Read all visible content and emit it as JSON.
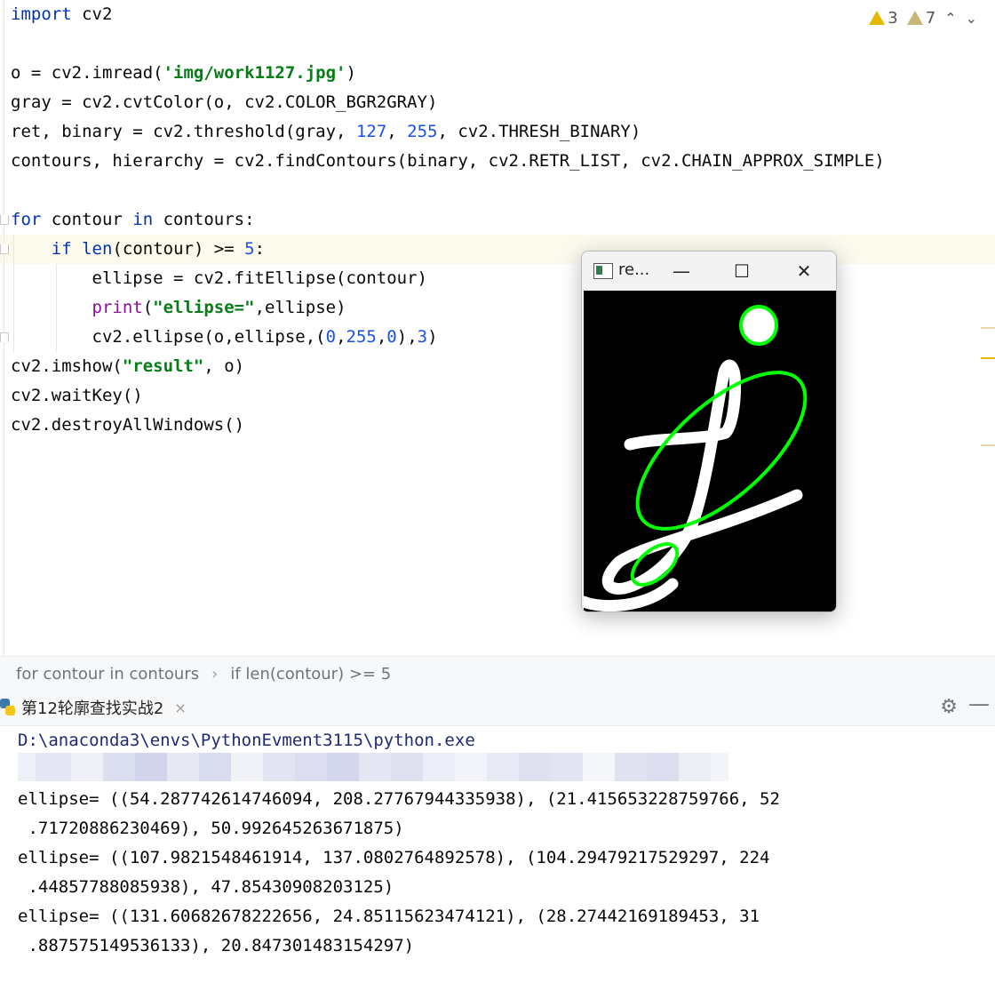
{
  "editor": {
    "lines": [
      [
        {
          "t": "import",
          "c": "kw"
        },
        {
          "t": " cv2",
          "c": ""
        }
      ],
      [],
      [
        {
          "t": "o = cv2.imread(",
          "c": ""
        },
        {
          "t": "'img/work1127.jpg'",
          "c": "str"
        },
        {
          "t": ")",
          "c": ""
        }
      ],
      [
        {
          "t": "gray = cv2.cvtColor(o, cv2.COLOR_BGR2GRAY)",
          "c": ""
        }
      ],
      [
        {
          "t": "ret, binary = cv2.threshold(gray, ",
          "c": ""
        },
        {
          "t": "127",
          "c": "num"
        },
        {
          "t": ", ",
          "c": ""
        },
        {
          "t": "255",
          "c": "num"
        },
        {
          "t": ", cv2.THRESH_BINARY)",
          "c": ""
        }
      ],
      [
        {
          "t": "contours, hierarchy = cv2.findContours(binary, cv2.RETR_LIST, cv2.CHAIN_APPROX_SIMPLE)",
          "c": ""
        }
      ],
      [],
      [
        {
          "t": "for",
          "c": "kw"
        },
        {
          "t": " contour ",
          "c": ""
        },
        {
          "t": "in",
          "c": "kw"
        },
        {
          "t": " contours:",
          "c": ""
        }
      ],
      [
        {
          "t": "    ",
          "c": ""
        },
        {
          "t": "if",
          "c": "kw"
        },
        {
          "t": " ",
          "c": ""
        },
        {
          "t": "len",
          "c": "kw"
        },
        {
          "t": "(contour) >= ",
          "c": ""
        },
        {
          "t": "5",
          "c": "num"
        },
        {
          "t": ":",
          "c": ""
        }
      ],
      [
        {
          "t": "        ellipse = cv2.fitEllipse(contour)",
          "c": ""
        }
      ],
      [
        {
          "t": "        ",
          "c": ""
        },
        {
          "t": "print",
          "c": "fn"
        },
        {
          "t": "(",
          "c": ""
        },
        {
          "t": "\"ellipse=\"",
          "c": "str"
        },
        {
          "t": ",ellipse)",
          "c": ""
        }
      ],
      [
        {
          "t": "        cv2.ellipse(o,ellipse,(",
          "c": ""
        },
        {
          "t": "0",
          "c": "num"
        },
        {
          "t": ",",
          "c": ""
        },
        {
          "t": "255",
          "c": "num"
        },
        {
          "t": ",",
          "c": ""
        },
        {
          "t": "0",
          "c": "num"
        },
        {
          "t": "),",
          "c": ""
        },
        {
          "t": "3",
          "c": "num"
        },
        {
          "t": ")",
          "c": ""
        }
      ],
      [
        {
          "t": "cv2.imshow(",
          "c": ""
        },
        {
          "t": "\"result\"",
          "c": "str"
        },
        {
          "t": ", o)",
          "c": ""
        }
      ],
      [
        {
          "t": "cv2.waitKey()",
          "c": ""
        }
      ],
      [
        {
          "t": "cv2.destroyAllWindows()",
          "c": ""
        }
      ]
    ],
    "warnings_count": "3",
    "weak_warnings_count": "7"
  },
  "breadcrumb": {
    "items": [
      "for contour in contours",
      "if len(contour) >= 5"
    ],
    "separator": "›"
  },
  "run_panel": {
    "tab_label": "第12轮廓查找实战2",
    "tab_close": "×",
    "gear_icon": "gear-icon",
    "minimize_icon": "minus-icon"
  },
  "console": {
    "path": "D:\\anaconda3\\envs\\PythonEvment3115\\python.exe",
    "output_lines": [
      "ellipse= ((54.287742614746094, 208.27767944335938), (21.415653228759766, 52",
      " .71720886230469), 50.992645263671875)",
      "ellipse= ((107.9821548461914, 137.0802764892578), (104.2947921752929​7, 224",
      " .44857788085938), 47.85430908203125)",
      "ellipse= ((131.60682678222656, 24.85115623474121), (28.27442169189453, 31",
      " .887575149536133), 20.847301483154297)"
    ]
  },
  "result_window": {
    "title": "re...",
    "minimize": "—",
    "maximize": "☐",
    "close": "✕"
  },
  "colors": {
    "keyword": "#0033b3",
    "string": "#067d17",
    "number": "#1750eb",
    "ellipse_green": "#00ff00"
  }
}
